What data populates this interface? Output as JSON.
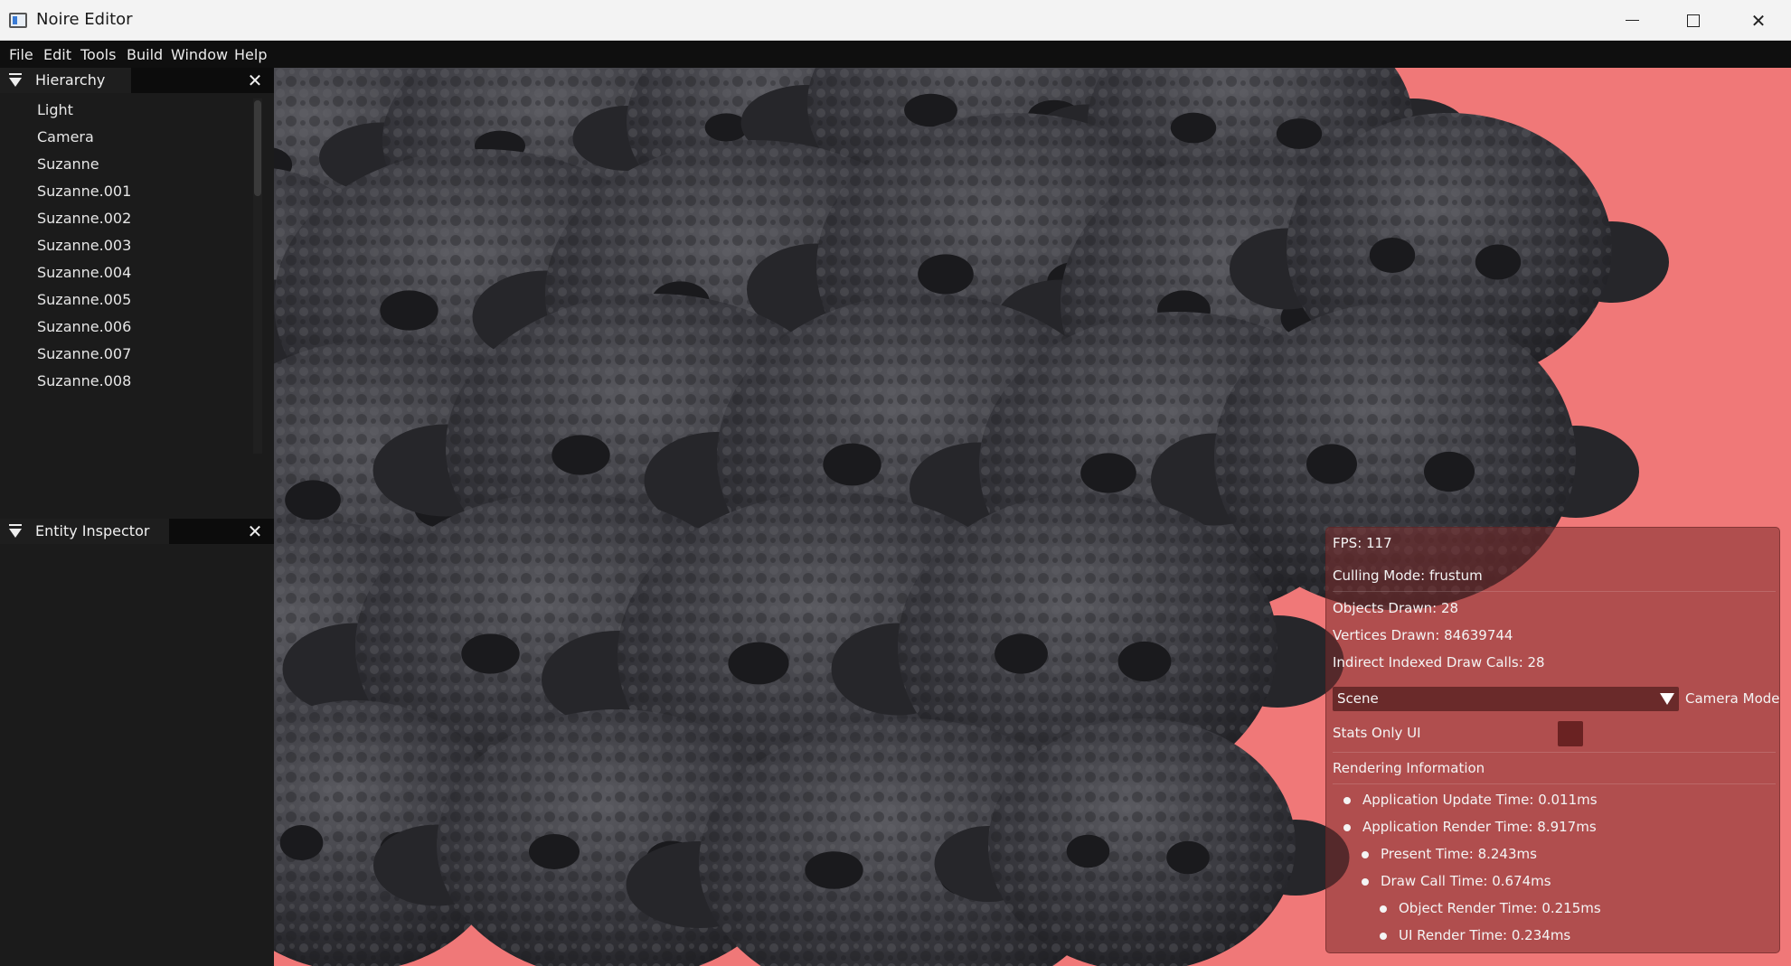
{
  "window": {
    "title": "Noire Editor",
    "minimize_icon": "minimize-icon",
    "maximize_icon": "maximize-icon",
    "close_icon": "close-icon"
  },
  "menu": [
    "File",
    "Edit",
    "Tools",
    "Build",
    "Window",
    "Help"
  ],
  "hierarchy": {
    "tab_label": "Hierarchy",
    "items": [
      "Light",
      "Camera",
      "Suzanne",
      "Suzanne.001",
      "Suzanne.002",
      "Suzanne.003",
      "Suzanne.004",
      "Suzanne.005",
      "Suzanne.006",
      "Suzanne.007",
      "Suzanne.008"
    ]
  },
  "inspector": {
    "tab_label": "Entity Inspector"
  },
  "stats": {
    "fps": "FPS: 117",
    "culling": "Culling Mode: frustum",
    "objects_drawn": "Objects Drawn: 28",
    "vertices_drawn": "Vertices Drawn: 84639744",
    "draw_calls": "Indirect Indexed Draw Calls: 28",
    "camera_mode_value": "Scene",
    "camera_mode_label": "Camera Mode",
    "stats_only_label": "Stats Only UI",
    "rendering_header": "Rendering Information",
    "app_update": "Application Update Time: 0.011ms",
    "app_render": "Application Render Time: 8.917ms",
    "present": "Present Time: 8.243ms",
    "draw_call_time": "Draw Call Time: 0.674ms",
    "object_render": "Object Render Time: 0.215ms",
    "ui_render": "UI Render Time: 0.234ms"
  },
  "colors": {
    "viewport_background": "#f07878",
    "mesh_dark": "#2a2a2f",
    "mesh_light": "#55555b",
    "panel_background": "#1b1b1b",
    "overlay_background": "#7c2c2c"
  }
}
